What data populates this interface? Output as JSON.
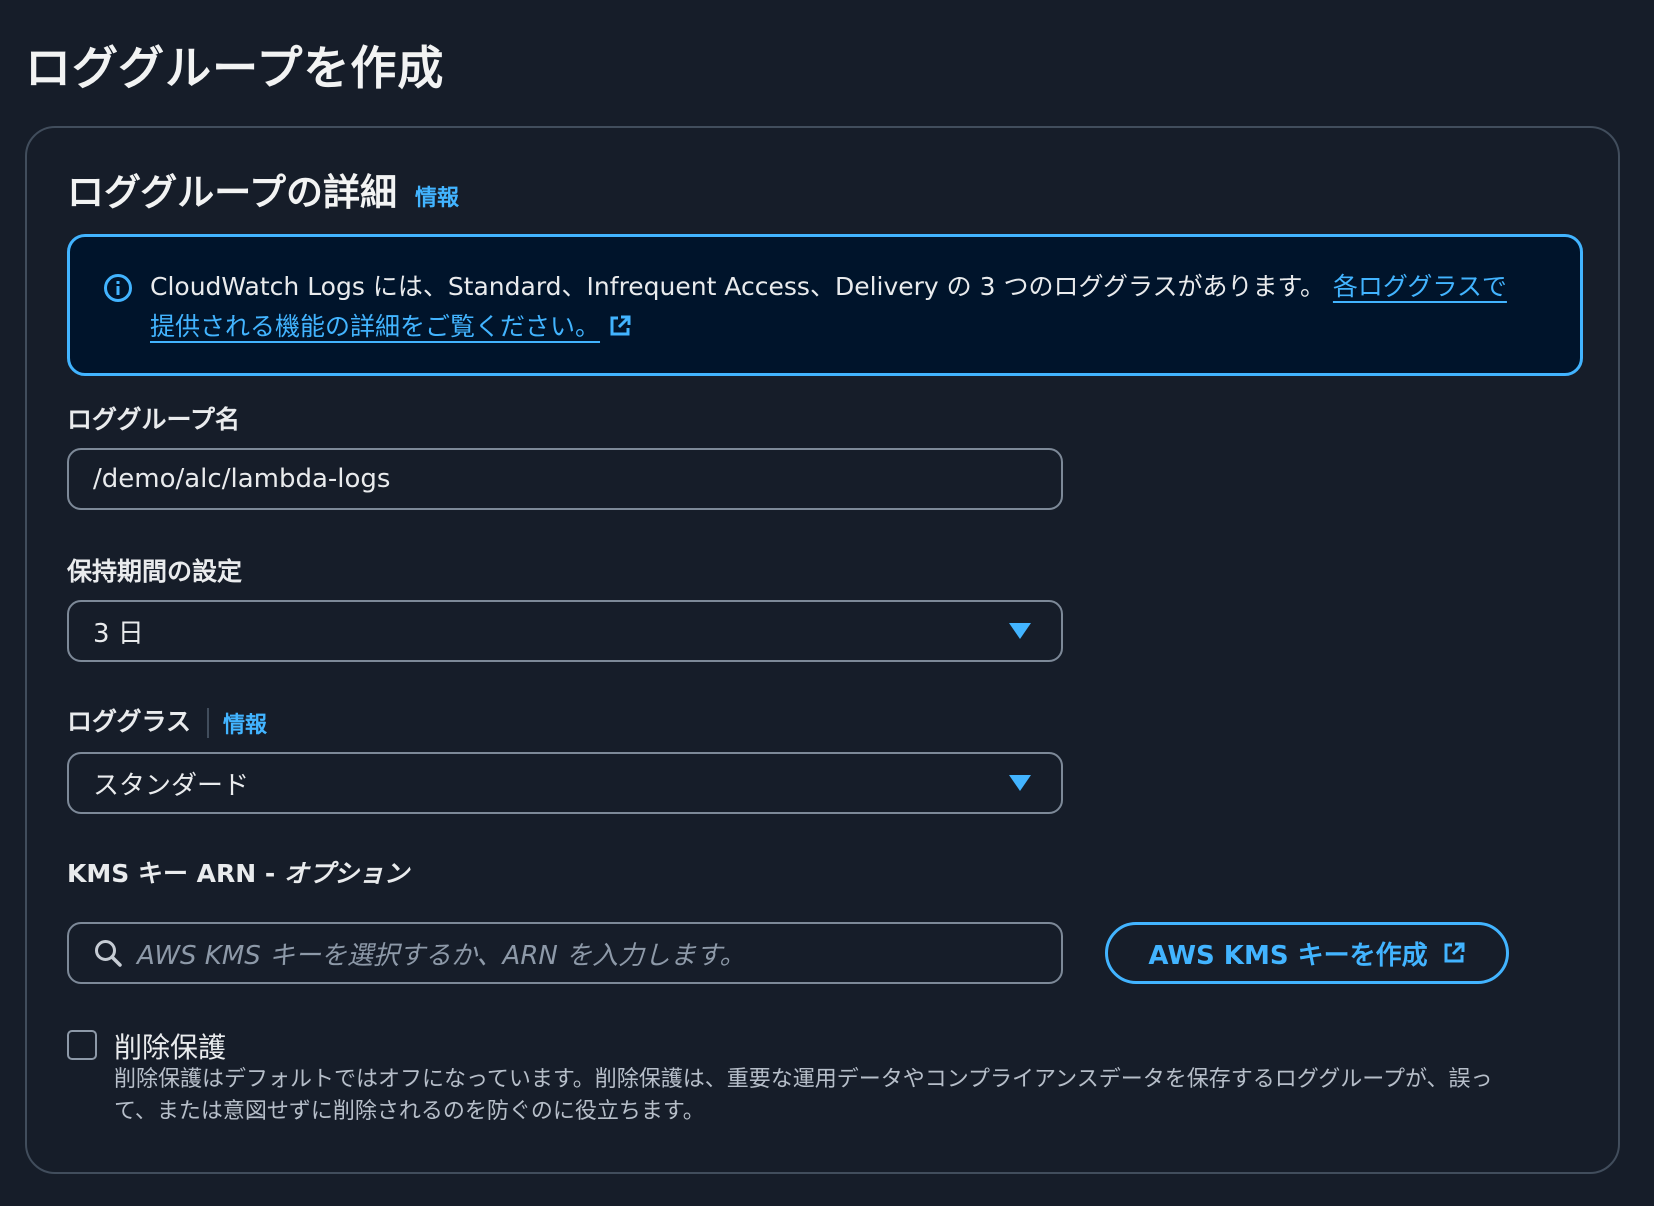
{
  "page": {
    "title": "ロググループを作成"
  },
  "section": {
    "title": "ロググループの詳細",
    "info_link": "情報"
  },
  "flash": {
    "icon": "info-icon",
    "text": "CloudWatch Logs には、Standard、Infrequent Access、Delivery の 3 つのロググラスがあります。",
    "link_text": "各ロググラスで提供される機能の詳細をご覧ください。",
    "link_icon": "external-link-icon"
  },
  "log_group_name": {
    "label": "ロググループ名",
    "value": "/demo/alc/lambda-logs"
  },
  "retention": {
    "label": "保持期間の設定",
    "value": "3 日"
  },
  "log_class": {
    "label": "ロググラス",
    "info_link": "情報",
    "value": "スタンダード"
  },
  "kms": {
    "label": "KMS キー ARN - ",
    "label_optional": "オプション",
    "placeholder": "AWS KMS キーを選択するか、ARN を入力します。",
    "create_button": "AWS KMS キーを作成"
  },
  "deletion_protection": {
    "label": "削除保護",
    "checked": false,
    "description": "削除保護はデフォルトではオフになっています。削除保護は、重要な運用データやコンプライアンスデータを保存するロググループが、誤って、または意図せずに削除されるのを防ぐのに役立ちます。"
  },
  "colors": {
    "background": "#161d29",
    "accent": "#42b4ff",
    "flash_background": "#00142b",
    "border": "#7d8998"
  }
}
